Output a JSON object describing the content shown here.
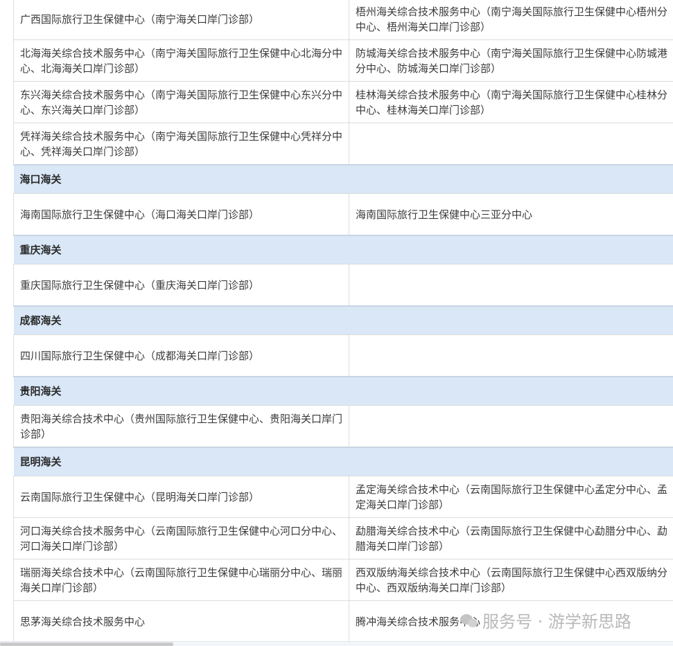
{
  "rows": [
    {
      "type": "pair",
      "left": "广西国际旅行卫生保健中心（南宁海关口岸门诊部）",
      "right": "梧州海关综合技术服务中心（南宁海关国际旅行卫生保健中心梧州分中心、梧州海关口岸门诊部）"
    },
    {
      "type": "pair",
      "left": "北海海关综合技术服务中心（南宁海关国际旅行卫生保健中心北海分中心、北海海关口岸门诊部）",
      "right": "防城海关综合技术服务中心（南宁海关国际旅行卫生保健中心防城港分中心、防城海关口岸门诊部）"
    },
    {
      "type": "pair",
      "left": "东兴海关综合技术服务中心（南宁海关国际旅行卫生保健中心东兴分中心、东兴海关口岸门诊部）",
      "right": "桂林海关综合技术服务中心（南宁海关国际旅行卫生保健中心桂林分中心、桂林海关口岸门诊部）"
    },
    {
      "type": "pair",
      "left": "凭祥海关综合技术服务中心（南宁海关国际旅行卫生保健中心凭祥分中心、凭祥海关口岸门诊部）",
      "right": ""
    },
    {
      "type": "section",
      "title": "海口海关"
    },
    {
      "type": "pair",
      "left": "海南国际旅行卫生保健中心（海口海关口岸门诊部）",
      "right": "海南国际旅行卫生保健中心三亚分中心"
    },
    {
      "type": "section",
      "title": "重庆海关"
    },
    {
      "type": "pair",
      "left": "重庆国际旅行卫生保健中心（重庆海关口岸门诊部）",
      "right": ""
    },
    {
      "type": "section",
      "title": "成都海关"
    },
    {
      "type": "pair",
      "left": "四川国际旅行卫生保健中心（成都海关口岸门诊部）",
      "right": ""
    },
    {
      "type": "section",
      "title": "贵阳海关"
    },
    {
      "type": "pair",
      "left": "贵阳海关综合技术中心（贵州国际旅行卫生保健中心、贵阳海关口岸门诊部）",
      "right": ""
    },
    {
      "type": "section",
      "title": "昆明海关"
    },
    {
      "type": "pair",
      "left": "云南国际旅行卫生保健中心（昆明海关口岸门诊部）",
      "right": "孟定海关综合技术中心（云南国际旅行卫生保健中心孟定分中心、孟定海关口岸门诊部）"
    },
    {
      "type": "pair",
      "left": "河口海关综合技术服务中心（云南国际旅行卫生保健中心河口分中心、河口海关口岸门诊部）",
      "right": "勐腊海关综合技术中心（云南国际旅行卫生保健中心勐腊分中心、勐腊海关口岸门诊部）"
    },
    {
      "type": "pair",
      "left": "瑞丽海关综合技术中心（云南国际旅行卫生保健中心瑞丽分中心、瑞丽海关口岸门诊部）",
      "right": "西双版纳海关综合技术中心（云南国际旅行卫生保健中心西双版纳分中心、西双版纳海关口岸门诊部）"
    },
    {
      "type": "pair",
      "left": "思茅海关综合技术服务中心",
      "right": "腾冲海关综合技术服务中心"
    }
  ],
  "watermark": {
    "icon": "wechat-official-account-icon",
    "text": "服务号 · 游学新思路"
  }
}
